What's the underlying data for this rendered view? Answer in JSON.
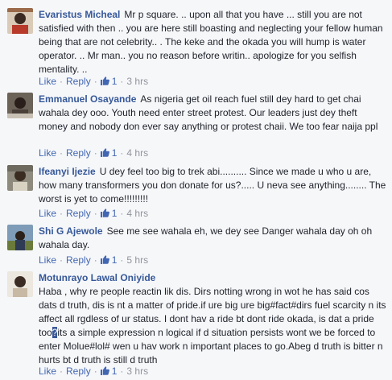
{
  "comments": [
    {
      "author": "Evaristus Micheal",
      "text": "Mr p square. .. upon all that you have ... still you are not satisfied with then .. you are here still boasting and neglecting your fellow human being that are not celebrity.. . The keke and the okada you will hump is water operator. .. Mr man.. you no reason before writin.. apologize for you selfish mentality. ..",
      "like_label": "Like",
      "reply_label": "Reply",
      "likes": "1",
      "time": "3 hrs"
    },
    {
      "author": "Emmanuel Osayande",
      "text": "As nigeria get oil reach fuel still dey hard to get chai wahala dey ooo. Youth need enter street protest. Our leaders just dey theft money and nobody don ever say anything or protest chaii. We too fear naija ppl",
      "like_label": "Like",
      "reply_label": "Reply",
      "likes": "1",
      "time": "4 hrs"
    },
    {
      "author": "Ifeanyi Ijezie",
      "text": "U dey feel too big to trek abi.......... Since we made u who u are, how many transformers you don donate for us?..... U neva see anything........ The worst is yet to come!!!!!!!!!",
      "like_label": "Like",
      "reply_label": "Reply",
      "likes": "1",
      "time": "4 hrs"
    },
    {
      "author": "Shi G Ajewole",
      "text": "See me see wahala eh, we dey see Danger wahala day oh oh wahala day.",
      "like_label": "Like",
      "reply_label": "Reply",
      "likes": "1",
      "time": "5 hrs"
    },
    {
      "author": "Motunrayo Lawal Oniyide",
      "text_before": "Haba , why re people reactin lik dis. Dirs notting wrong in wot he has said cos dats d truth, dis is nt a matter of pride.if ure big ure big#fact#dirs fuel scarcity n its affect all rgdless of ur status. I dont hav a ride bt dont ride okada, is dat a pride too",
      "text_highlight": "?",
      "text_after": "its a simple expression n logical if d situation persists wont we be forced to enter Molue#lol# wen u hav work n important places to go.Abeg d truth is bitter n hurts bt d truth is still d truth",
      "like_label": "Like",
      "reply_label": "Reply",
      "likes": "1",
      "time": "3 hrs"
    }
  ],
  "colors": {
    "author": "#365899",
    "link": "#4267b2",
    "meta": "#90949c",
    "text": "#1d2129",
    "background": "#f6f7f9"
  },
  "icons": {
    "like_count": "thumbs-up-icon"
  }
}
